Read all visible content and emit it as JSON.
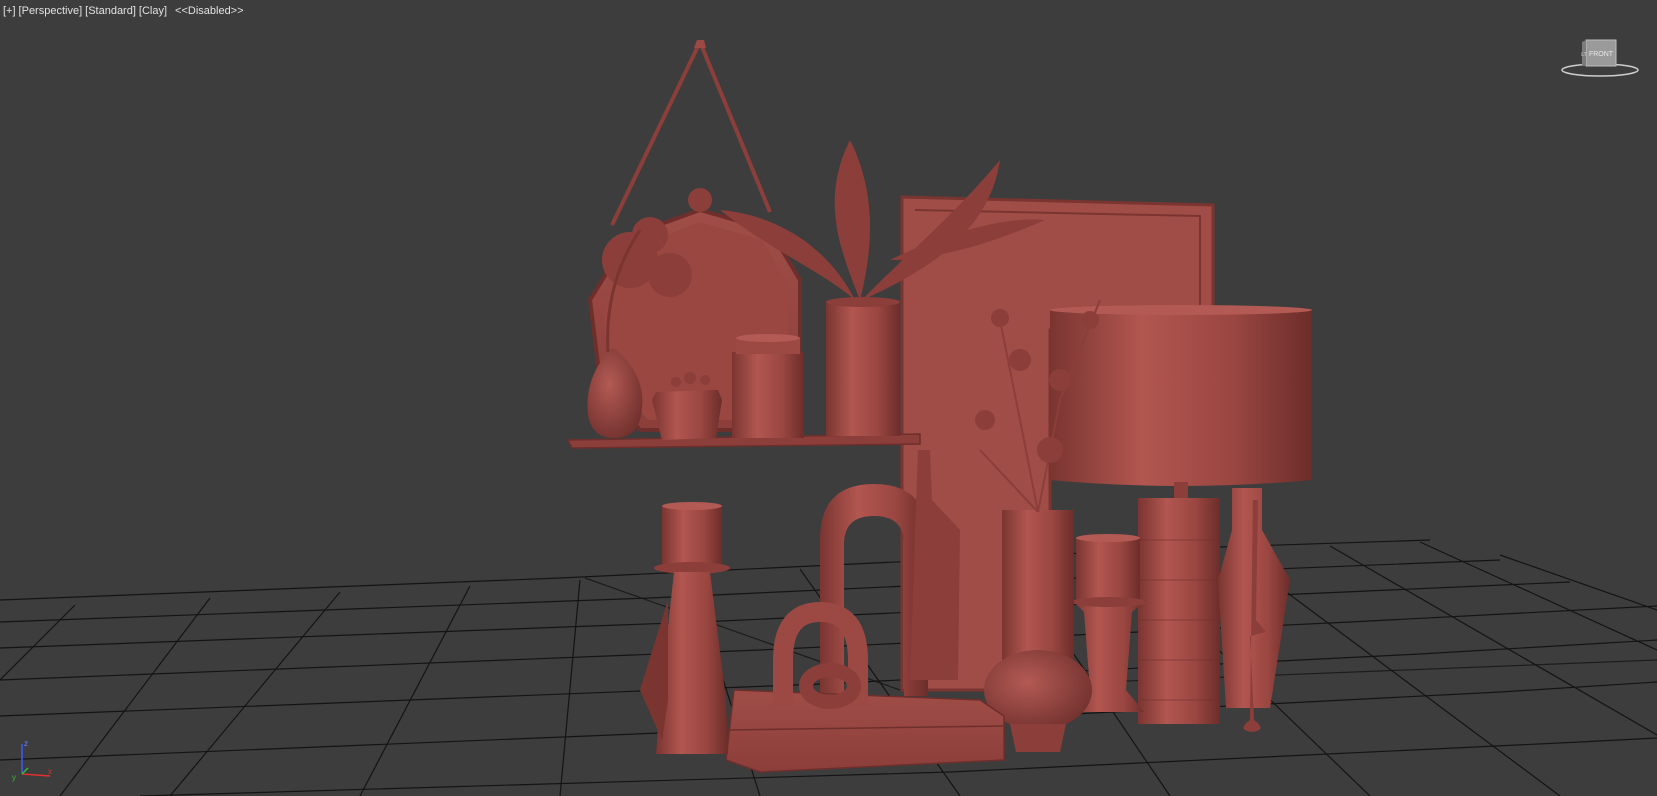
{
  "viewport": {
    "menu_plus": "[+]",
    "view_label": "[Perspective]",
    "camera_label": "[Standard]",
    "shading_label": "[Clay]",
    "status_label": "<<Disabled>>"
  },
  "viewcube": {
    "face_label": "FRONT",
    "side_label": "LT"
  },
  "axis": {
    "x": "x",
    "y": "y",
    "z": "z"
  },
  "colors": {
    "background": "#3d3d3d",
    "grid": "#141414",
    "clay": "#9c4944",
    "clay_dark": "#6e2f2c",
    "clay_light": "#b45a54",
    "label_text": "#e2e2e2"
  }
}
